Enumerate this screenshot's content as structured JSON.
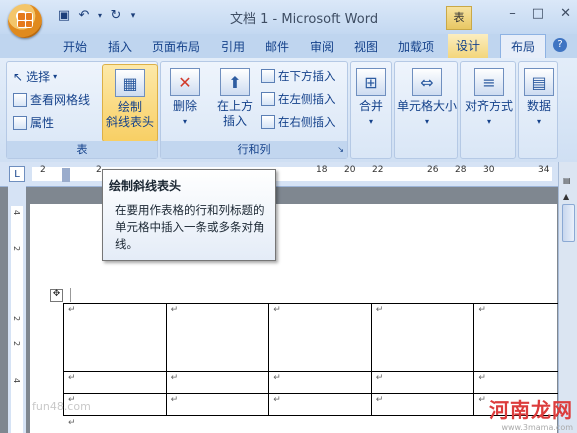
{
  "window": {
    "title": "文档 1 - Microsoft Word",
    "context_tab": "表",
    "controls": [
      "–",
      "□",
      "✕"
    ]
  },
  "quick_access": [
    "save-icon",
    "undo-icon",
    "redo-icon",
    "customize-icon"
  ],
  "tabs": [
    {
      "label": "开始"
    },
    {
      "label": "插入"
    },
    {
      "label": "页面布局"
    },
    {
      "label": "引用"
    },
    {
      "label": "邮件"
    },
    {
      "label": "审阅"
    },
    {
      "label": "视图"
    },
    {
      "label": "加载项"
    },
    {
      "label": "设计"
    },
    {
      "label": "布局"
    }
  ],
  "ribbon": {
    "table_group": {
      "label": "表",
      "select": "选择",
      "gridlines": "查看网格线",
      "properties": "属性",
      "draw_diagonal": "绘制\n斜线表头"
    },
    "rows_cols_group": {
      "label": "行和列",
      "delete": "删除",
      "insert_above": "在上方\n插入",
      "insert_below": "在下方插入",
      "insert_left": "在左侧插入",
      "insert_right": "在右侧插入"
    },
    "merge": "合并",
    "cell_size": "单元格大小",
    "alignment": "对齐方式",
    "data": "数据"
  },
  "ruler": {
    "tab_marker": "L",
    "numbers": [
      "2",
      "2",
      "18",
      "20",
      "22",
      "26",
      "28",
      "30",
      "34"
    ],
    "vertical_numbers": [
      "4",
      "2",
      "2",
      "2",
      "4"
    ]
  },
  "tooltip": {
    "title": "绘制斜线表头",
    "body": "在要用作表格的行和列标题的单元格中插入一条或多条对角线。"
  },
  "document": {
    "table_rows": [
      [
        "↵",
        "↵",
        "↵",
        "↵",
        "↵"
      ],
      [
        "↵",
        "↵",
        "↵",
        "↵",
        "↵"
      ],
      [
        "↵",
        "↵",
        "↵",
        "↵",
        "↵"
      ]
    ],
    "after_table_mark": "↵"
  },
  "watermarks": {
    "left": "fun48.com",
    "right_brand": "河南龙网",
    "right_url": "www.3mama.com"
  }
}
